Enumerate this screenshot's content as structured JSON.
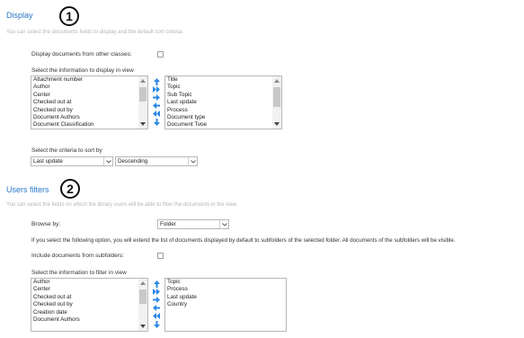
{
  "display": {
    "title": "Display",
    "badge": "1",
    "description": "You can select the documents fields to display and the default sort criteria.",
    "other_classes_label": "Display documents from other classes:",
    "info_label": "Select the information to display in view",
    "available_fields": [
      "Attachment number",
      "Author",
      "Center",
      "Checked out at",
      "Checked out by",
      "Document Authors",
      "Document Classification"
    ],
    "selected_fields": [
      "Title",
      "Topic",
      "Sub Topic",
      "Last update",
      "Process",
      "Document type",
      "Document Type"
    ],
    "sort_label": "Select the criteria to sort by",
    "sort_field": "Last update",
    "sort_order": "Descending"
  },
  "users_filters": {
    "title": "Users filters",
    "badge": "2",
    "description": "You can select the fields on which the library users will be able to filter the documents in the view.",
    "browse_label": "Browse by:",
    "browse_value": "Folder",
    "subfolder_note": "If you select the following option, you will extend the list of documents displayed by default to subfolders of the selected folder. All documents of the subfolders will be visible.",
    "include_label": "Include documents from subfolders:",
    "filter_label": "Select the information to filter in view",
    "available_fields": [
      "Author",
      "Center",
      "Checked out at",
      "Checked out by",
      "Creation date",
      "Document Authors"
    ],
    "selected_fields": [
      "Topic",
      "Process",
      "Last update",
      "Country"
    ]
  },
  "colors": {
    "accent": "#2a76c6",
    "arrow": "#2a86e6"
  },
  "icons": [
    "arrow-up-icon",
    "double-right-icon",
    "arrow-right-icon",
    "arrow-left-icon",
    "double-left-icon",
    "arrow-down-icon",
    "chevron-down-icon"
  ]
}
